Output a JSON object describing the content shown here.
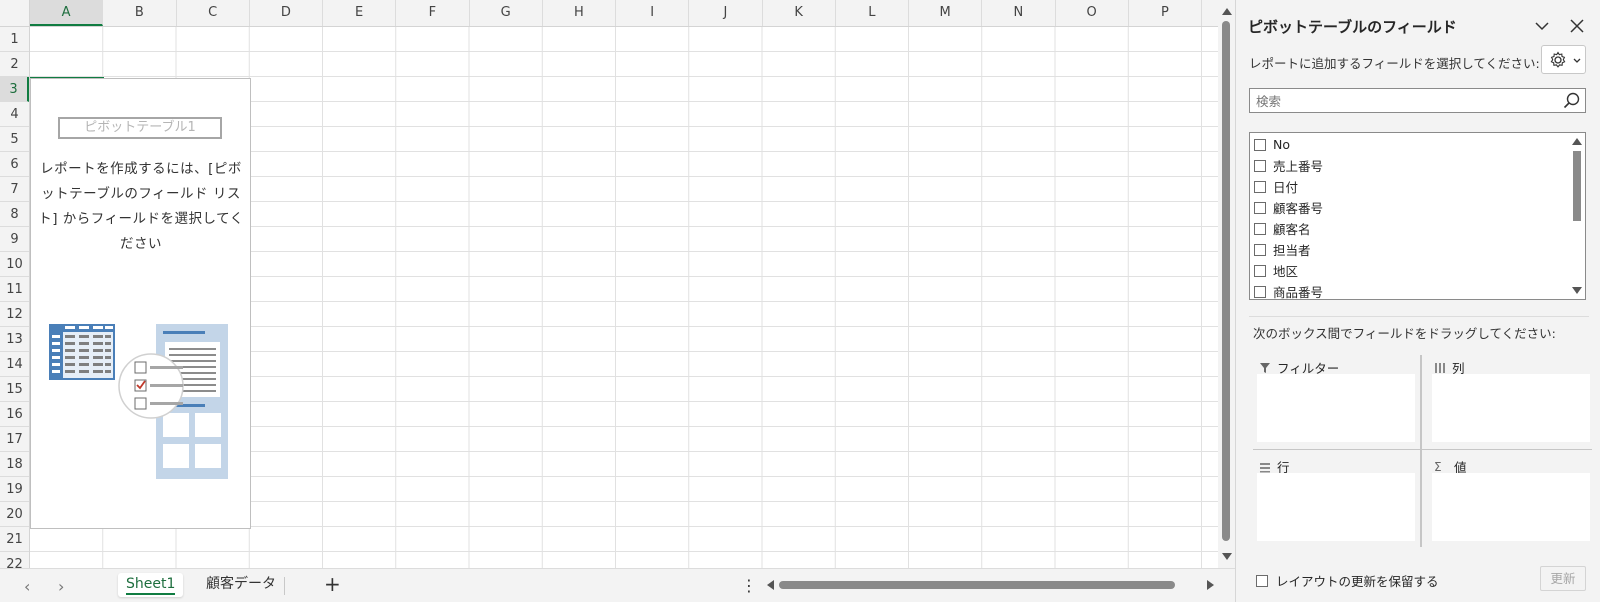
{
  "columns": [
    "A",
    "B",
    "C",
    "D",
    "E",
    "F",
    "G",
    "H",
    "I",
    "J",
    "K",
    "L",
    "M",
    "N",
    "O",
    "P"
  ],
  "rows": [
    "1",
    "2",
    "3",
    "4",
    "5",
    "6",
    "7",
    "8",
    "9",
    "10",
    "11",
    "12",
    "13",
    "14",
    "15",
    "16",
    "17",
    "18",
    "19",
    "20",
    "21",
    "22"
  ],
  "selected_cell": {
    "column": "A",
    "row": "3"
  },
  "pivot_placeholder": {
    "name": "ピボットテーブル1",
    "instruction": "レポートを作成するには、[ピボットテーブルのフィールド リスト] からフィールドを選択してください"
  },
  "sheet_tabs": {
    "tabs": [
      {
        "label": "Sheet1",
        "active": true
      },
      {
        "label": "顧客データ",
        "active": false
      }
    ],
    "add_label": "+",
    "menu_label": "⋮"
  },
  "field_pane": {
    "title": "ピボットテーブルのフィールド",
    "select_prompt": "レポートに追加するフィールドを選択してください:",
    "search_placeholder": "検索",
    "fields": [
      "No",
      "売上番号",
      "日付",
      "顧客番号",
      "顧客名",
      "担当者",
      "地区",
      "商品番号"
    ],
    "drag_prompt": "次のボックス間でフィールドをドラッグしてください:",
    "areas": {
      "filter": "フィルター",
      "columns": "列",
      "rows": "行",
      "values": "値"
    },
    "defer_label": "レイアウトの更新を保留する",
    "update_label": "更新"
  },
  "colors": {
    "accent": "#107c41",
    "header_bg": "#f3f3f3",
    "illustration_blue": "#4a7fb8",
    "illustration_light": "#c3d5e8"
  },
  "icons": [
    "chevron-down-icon",
    "close-icon",
    "gear-icon",
    "search-icon",
    "filter-icon",
    "columns-icon",
    "rows-icon",
    "sigma-icon"
  ]
}
